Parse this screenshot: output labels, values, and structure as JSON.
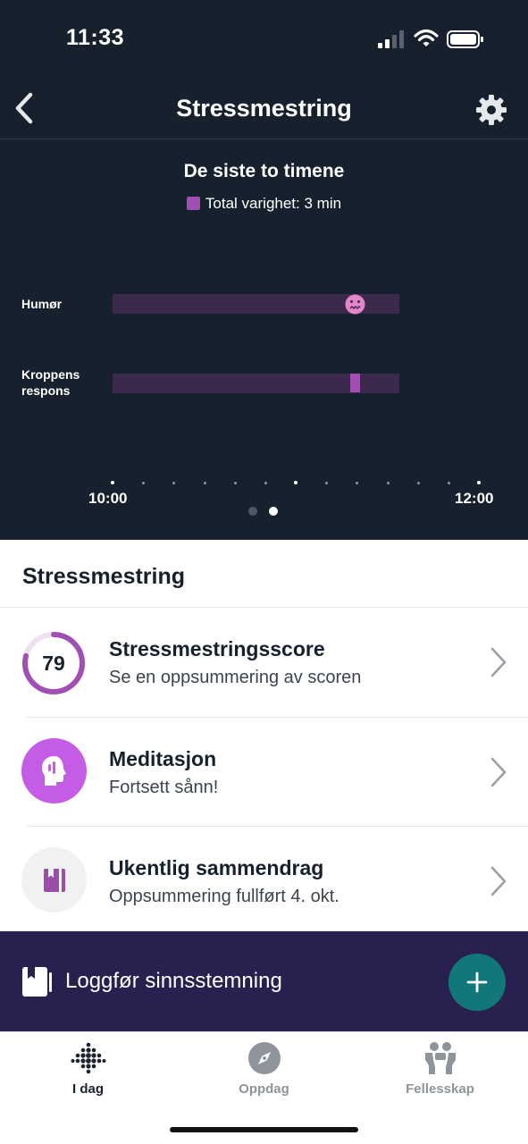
{
  "status_bar": {
    "time": "11:33"
  },
  "nav": {
    "title": "Stressmestring"
  },
  "chart_data": {
    "type": "timeline",
    "title": "De siste to timene",
    "legend": [
      {
        "label": "Total varighet: 3 min",
        "color": "#a24fb3"
      }
    ],
    "rows": [
      {
        "label": "Humør",
        "event_fraction": 0.85,
        "marker": "stressed-face"
      },
      {
        "label": "Kroppens respons",
        "event_fraction": 0.85,
        "marker": "bar"
      }
    ],
    "x_ticks": [
      "10:00",
      "12:00"
    ],
    "range": [
      "10:00",
      "12:00"
    ]
  },
  "pagination": {
    "count": 2,
    "active": 2
  },
  "section": {
    "title": "Stressmestring"
  },
  "items": [
    {
      "title": "Stressmestringsscore",
      "subtitle": "Se en oppsummering av scoren",
      "score": "79",
      "score_fraction": 0.79,
      "icon": "score-ring-icon"
    },
    {
      "title": "Meditasjon",
      "subtitle": "Fortsett sånn!",
      "icon": "meditation-head-icon"
    },
    {
      "title": "Ukentlig sammendrag",
      "subtitle": "Oppsummering fullført 4. okt.",
      "icon": "notebook-icon"
    }
  ],
  "log_bar": {
    "label": "Loggfør sinnsstemning",
    "icon": "journal-icon"
  },
  "tabs": [
    {
      "label": "I dag",
      "icon": "fitbit-dots-icon",
      "active": true
    },
    {
      "label": "Oppdag",
      "icon": "compass-icon",
      "active": false
    },
    {
      "label": "Fellesskap",
      "icon": "community-icon",
      "active": false
    }
  ],
  "colors": {
    "dark_bg": "#17212e",
    "accent": "#a24fb3",
    "mood": "#e585c9",
    "meditation": "#c45ce6",
    "log_bar": "#28204f",
    "fab": "#12777a"
  }
}
